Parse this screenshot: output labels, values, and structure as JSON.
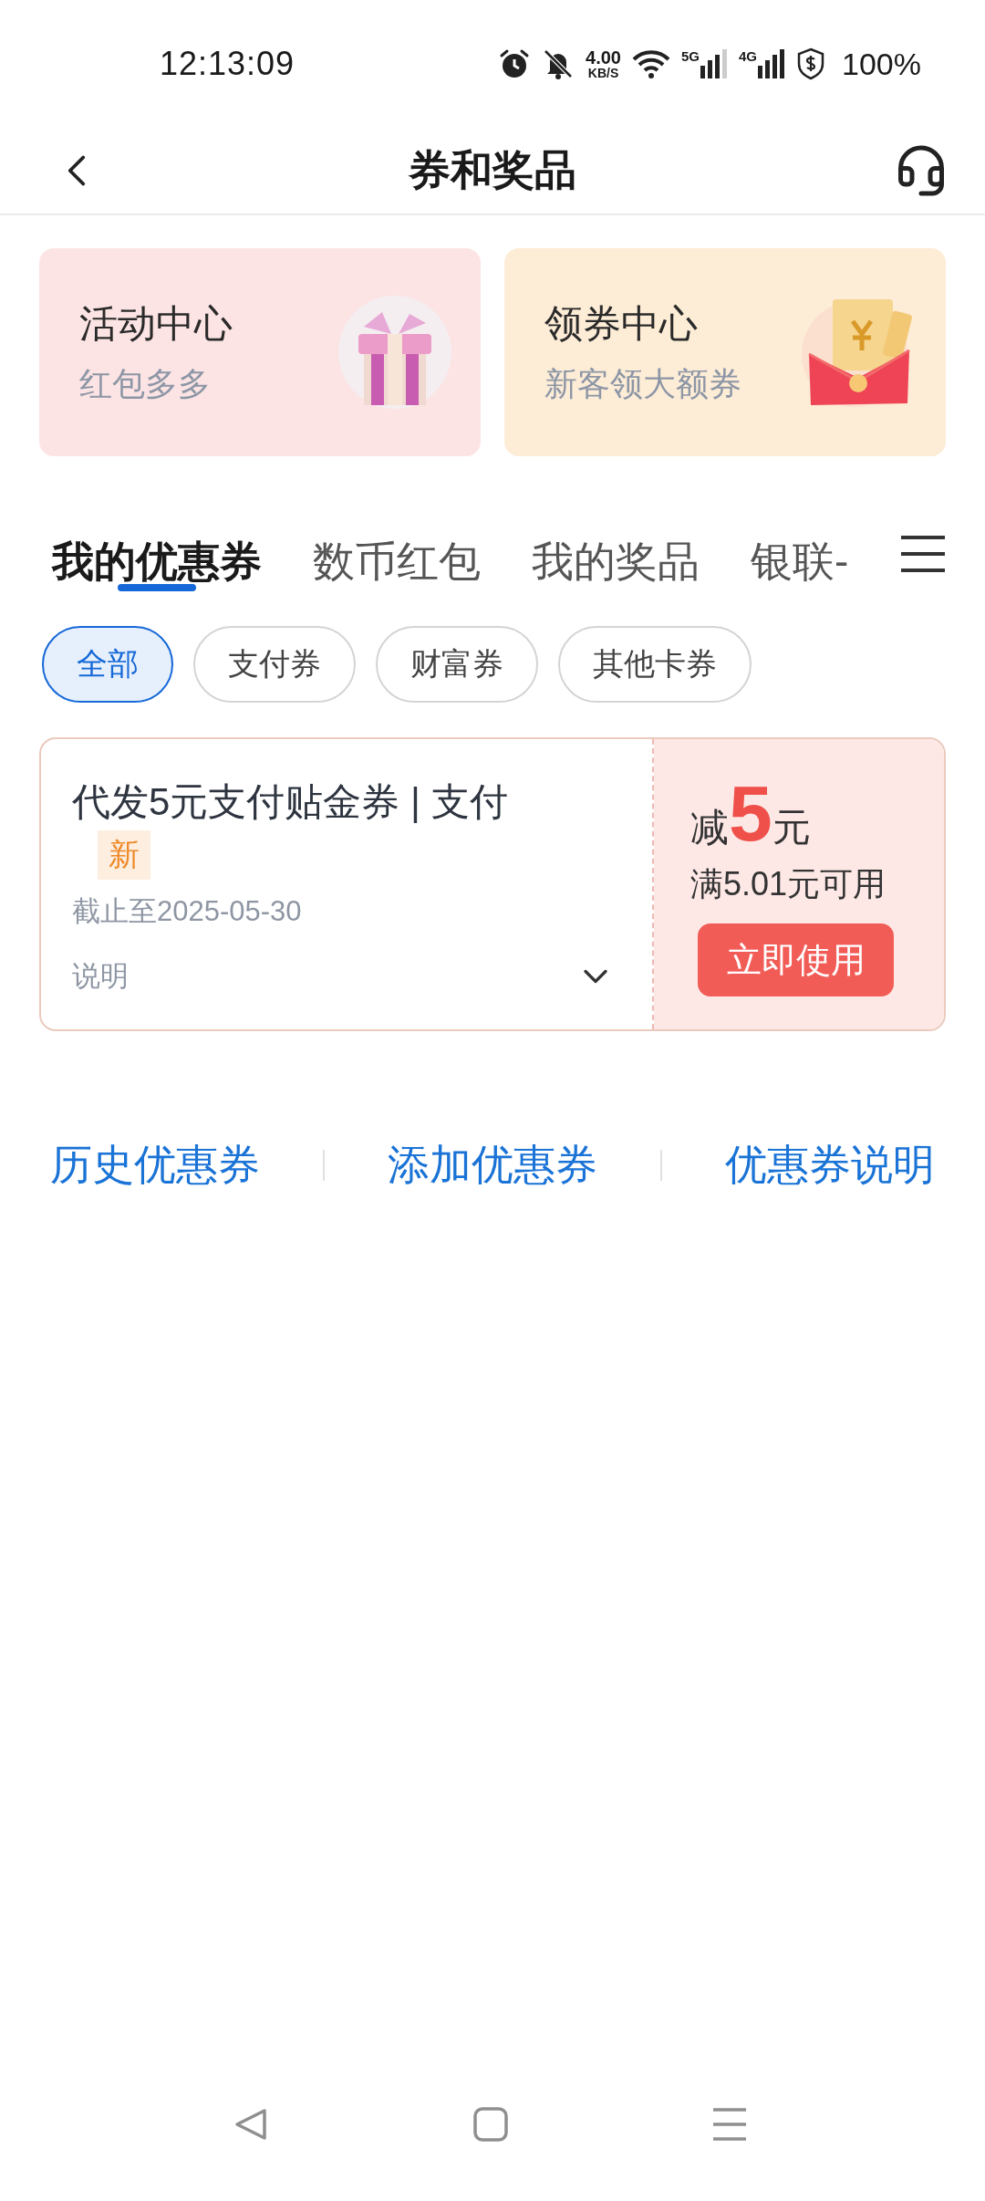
{
  "status_bar": {
    "time": "12:13:09",
    "net_speed": {
      "value": "4.00",
      "unit": "KB/S"
    },
    "signals": [
      {
        "label": "5G",
        "level": 0.75
      },
      {
        "label": "4G",
        "level": 1
      }
    ],
    "battery": "100%"
  },
  "header": {
    "title": "券和奖品"
  },
  "promo_cards": [
    {
      "title": "活动中心",
      "subtitle": "红包多多",
      "kind": "gift",
      "color": "#fde4e4"
    },
    {
      "title": "领券中心",
      "subtitle": "新客领大额券",
      "kind": "envelope",
      "color": "#fdecd6"
    }
  ],
  "tabs": [
    {
      "label": "我的优惠券",
      "selected": true
    },
    {
      "label": "数币红包",
      "selected": false
    },
    {
      "label": "我的奖品",
      "selected": false
    },
    {
      "label": "银联-",
      "selected": false
    }
  ],
  "filters": [
    {
      "label": "全部",
      "selected": true
    },
    {
      "label": "支付券",
      "selected": false
    },
    {
      "label": "财富券",
      "selected": false
    },
    {
      "label": "其他卡券",
      "selected": false
    }
  ],
  "coupons": [
    {
      "title": "代发5元支付贴金券 | 支付",
      "badge": "新",
      "expiry": "截止至2025-05-30",
      "note": "说明",
      "amount_prefix": "减",
      "amount": "5",
      "amount_unit": "元",
      "condition": "满5.01元可用",
      "button": "立即使用"
    }
  ],
  "footer_links": [
    "历史优惠券",
    "添加优惠券",
    "优惠券说明"
  ]
}
